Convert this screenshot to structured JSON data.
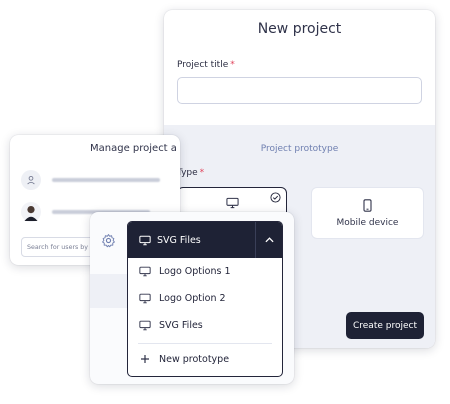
{
  "new_project": {
    "title": "New project",
    "project_title_label": "Project title",
    "required_mark": "*",
    "project_title_value": "",
    "prototype_section_title": "Project prototype",
    "type_label": "Type",
    "type_options": [
      {
        "label": "",
        "icon": "monitor-icon",
        "selected": true
      },
      {
        "label": "Mobile device",
        "icon": "smartphone-icon",
        "selected": false
      }
    ],
    "create_button": "Create project"
  },
  "manage_project": {
    "title": "Manage project a",
    "members": [
      {
        "avatar": "user-icon"
      },
      {
        "avatar": "profile-photo"
      }
    ],
    "search_placeholder": "Search for users by e"
  },
  "settings": {
    "icon": "gear-icon"
  },
  "prototype_dropdown": {
    "selected": "SVG Files",
    "items": [
      {
        "label": "Logo Options 1",
        "icon": "monitor-icon"
      },
      {
        "label": "Logo Option 2",
        "icon": "monitor-icon"
      },
      {
        "label": "SVG Files",
        "icon": "monitor-icon"
      }
    ],
    "new_item": {
      "label": "New prototype",
      "icon": "plus-icon"
    }
  },
  "colors": {
    "primary_dark": "#1e2235",
    "required_red": "#e0435b",
    "section_bg": "#eef0f6",
    "accent_text": "#6f7fb0"
  }
}
